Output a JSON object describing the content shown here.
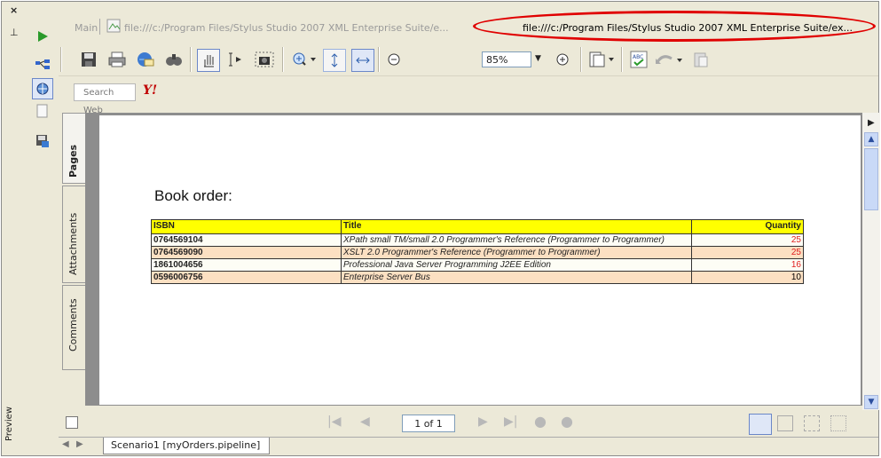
{
  "sidebar": {
    "preview_label": "Preview"
  },
  "tabs": {
    "main_label": "Main",
    "inactive_url": "file:///c:/Program Files/Stylus Studio 2007 XML Enterprise Suite/e...",
    "active_url": "file:///c:/Program Files/Stylus Studio 2007 XML Enterprise Suite/ex..."
  },
  "toolbar": {
    "zoom_value": "85%"
  },
  "searchbar": {
    "placeholder": "Search Web",
    "yahoo_label": "Y!"
  },
  "side_tabs": [
    "Pages",
    "Attachments",
    "Comments"
  ],
  "document": {
    "heading": "Book order:",
    "columns": [
      "ISBN",
      "Title",
      "Quantity"
    ],
    "rows": [
      {
        "isbn": "0764569104",
        "title": "XPath small TM/small 2.0 Programmer's Reference (Programmer to Programmer)",
        "qty": "25",
        "qty_color": "#e02020"
      },
      {
        "isbn": "0764569090",
        "title": "XSLT 2.0 Programmer's Reference (Programmer to Programmer)",
        "qty": "25",
        "qty_color": "#e02020"
      },
      {
        "isbn": "1861004656",
        "title": "Professional Java Server Programming J2EE Edition",
        "qty": "16",
        "qty_color": "#e02020"
      },
      {
        "isbn": "0596006756",
        "title": "Enterprise Server Bus",
        "qty": "10",
        "qty_color": "#000000"
      }
    ]
  },
  "pager": {
    "page_indicator": "1 of 1"
  },
  "doc_tab": {
    "label": "Scenario1 [myOrders.pipeline]"
  },
  "colors": {
    "header_fill": "#ffff00",
    "row_alt": "#fce0c2",
    "highlight_oval": "#e00000"
  }
}
